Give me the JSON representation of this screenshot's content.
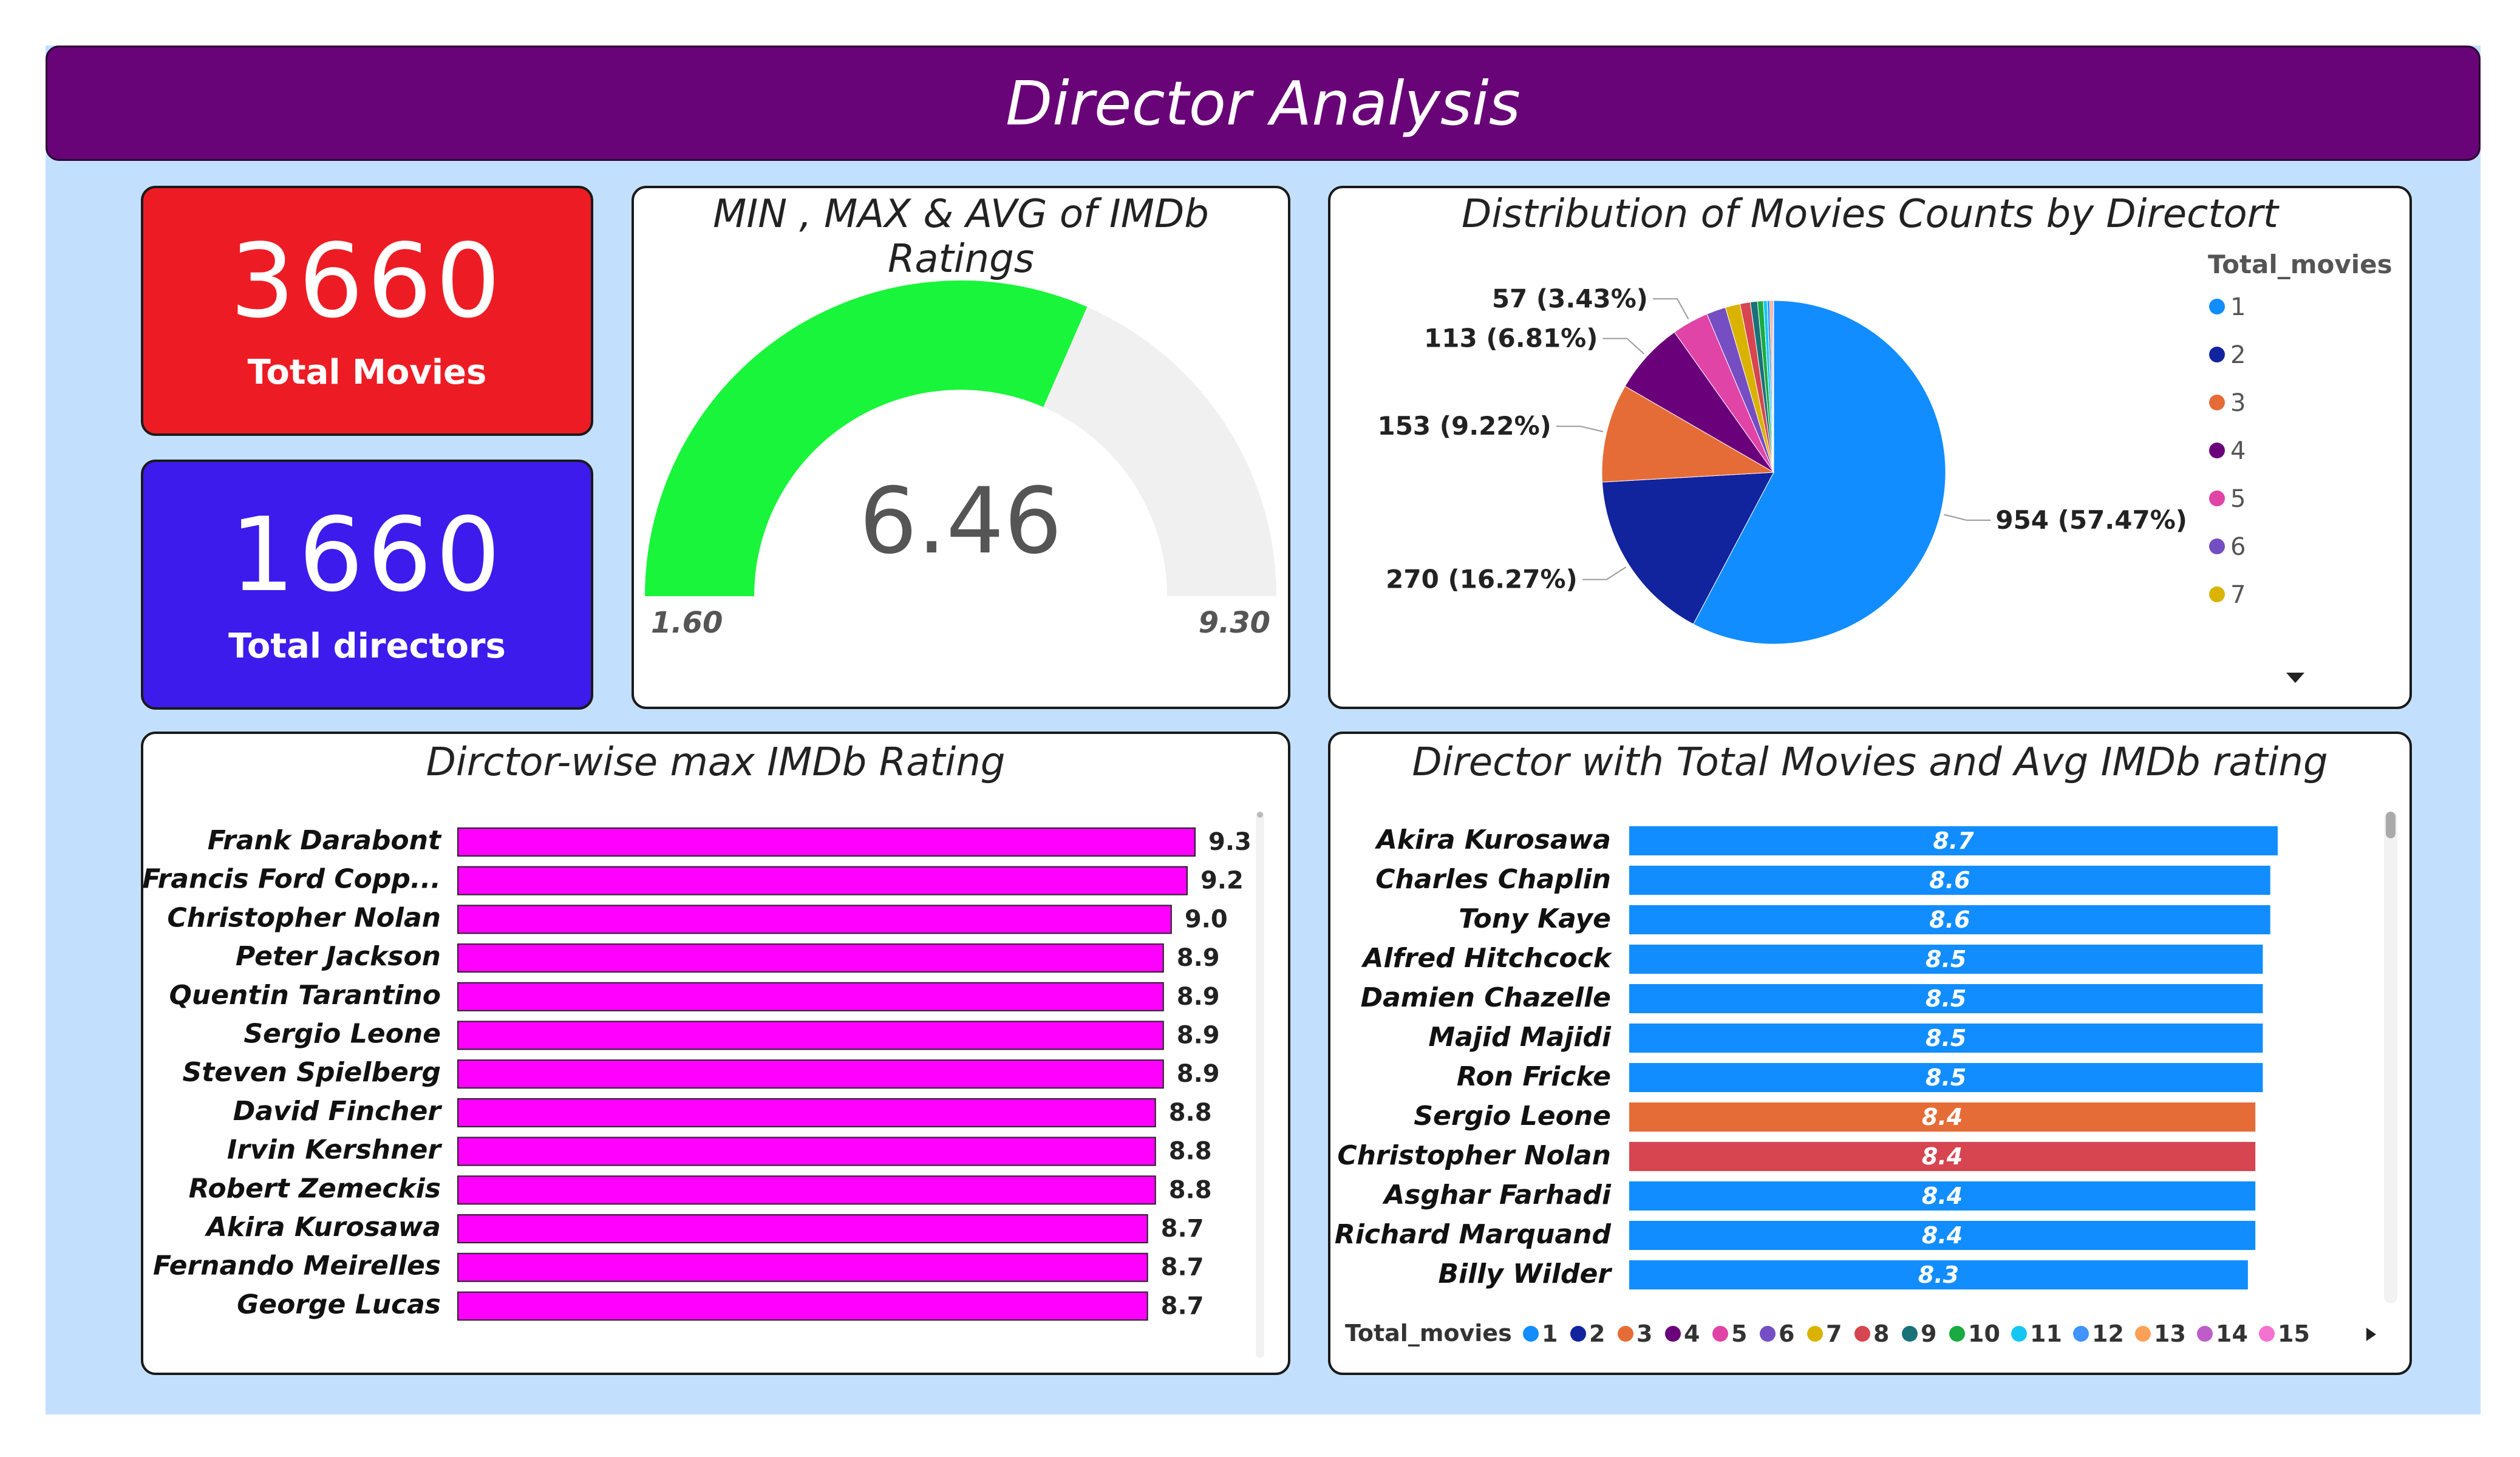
{
  "header": {
    "title": "Director Analysis"
  },
  "kpis": {
    "total_movies": {
      "value": "3660",
      "label": "Total Movies",
      "color": "#ed1c24"
    },
    "total_directors": {
      "value": "1660",
      "label": "Total directors",
      "color": "#3d1bec"
    }
  },
  "gauge": {
    "title": "MIN , MAX & AVG of IMDb Ratings",
    "value_label": "6.46",
    "min_label": "1.60",
    "max_label": "9.30",
    "min": 1.6,
    "max": 9.3,
    "value": 6.46,
    "fill_color": "#19f53a",
    "track_color": "#f0f0f0"
  },
  "pie": {
    "title": "Distribution of Movies Counts by Directort",
    "legend_title": "Total_movies",
    "legend_items": [
      {
        "label": "1",
        "color": "#118dff"
      },
      {
        "label": "2",
        "color": "#12239e"
      },
      {
        "label": "3",
        "color": "#e66c37"
      },
      {
        "label": "4",
        "color": "#6b007b"
      },
      {
        "label": "5",
        "color": "#e044a7"
      },
      {
        "label": "6",
        "color": "#744ec2"
      },
      {
        "label": "7",
        "color": "#d9b300"
      }
    ]
  },
  "bar_left": {
    "title": "Dirctor-wise max IMDb Rating"
  },
  "bar_right": {
    "title": "Director with Total Movies and Avg IMDb rating",
    "legend_title": "Total_movies",
    "legend_items": [
      {
        "label": "1",
        "color": "#118dff"
      },
      {
        "label": "2",
        "color": "#12239e"
      },
      {
        "label": "3",
        "color": "#e66c37"
      },
      {
        "label": "4",
        "color": "#6b007b"
      },
      {
        "label": "5",
        "color": "#e044a7"
      },
      {
        "label": "6",
        "color": "#744ec2"
      },
      {
        "label": "7",
        "color": "#d9b300"
      },
      {
        "label": "8",
        "color": "#d64550"
      },
      {
        "label": "9",
        "color": "#197278"
      },
      {
        "label": "10",
        "color": "#1aab40"
      },
      {
        "label": "11",
        "color": "#15c6f4"
      },
      {
        "label": "12",
        "color": "#4092ff"
      },
      {
        "label": "13",
        "color": "#ffa058"
      },
      {
        "label": "14",
        "color": "#be5dc9"
      },
      {
        "label": "15",
        "color": "#f472d0"
      }
    ]
  },
  "chart_data": [
    {
      "type": "gauge",
      "title": "MIN , MAX & AVG of IMDb Ratings",
      "min": 1.6,
      "max": 9.3,
      "value": 6.46
    },
    {
      "type": "pie",
      "title": "Distribution of Movies Counts by Directort",
      "legend_title": "Total_movies",
      "slices": [
        {
          "label": "1",
          "value": 954,
          "pct": "57.47%",
          "color": "#118dff",
          "data_label": "954 (57.47%)"
        },
        {
          "label": "2",
          "value": 270,
          "pct": "16.27%",
          "color": "#12239e",
          "data_label": "270 (16.27%)"
        },
        {
          "label": "3",
          "value": 153,
          "pct": "9.22%",
          "color": "#e66c37",
          "data_label": "153 (9.22%)"
        },
        {
          "label": "4",
          "value": 113,
          "pct": "6.81%",
          "color": "#6b007b",
          "data_label": "113 (6.81%)"
        },
        {
          "label": "5",
          "value": 57,
          "pct": "3.43%",
          "color": "#e044a7",
          "data_label": "57 (3.43%)"
        },
        {
          "label": "6",
          "value": 30,
          "color": "#744ec2"
        },
        {
          "label": "7",
          "value": 23,
          "color": "#d9b300"
        },
        {
          "label": "8",
          "value": 16,
          "color": "#d64550"
        },
        {
          "label": "9",
          "value": 11,
          "color": "#197278"
        },
        {
          "label": "10",
          "value": 9,
          "color": "#1aab40"
        },
        {
          "label": "11",
          "value": 6,
          "color": "#15c6f4"
        },
        {
          "label": "12",
          "value": 4,
          "color": "#4092ff"
        },
        {
          "label": "13",
          "value": 3,
          "color": "#ffa058"
        },
        {
          "label": "14",
          "value": 2,
          "color": "#be5dc9"
        },
        {
          "label": "15",
          "value": 1,
          "color": "#f472d0"
        }
      ]
    },
    {
      "type": "bar",
      "orientation": "horizontal",
      "title": "Dirctor-wise max IMDb Rating",
      "color": "#ff00ff",
      "categories": [
        "Frank Darabont",
        "Francis Ford Copp...",
        "Christopher Nolan",
        "Peter Jackson",
        "Quentin Tarantino",
        "Sergio Leone",
        "Steven Spielberg",
        "David Fincher",
        "Irvin Kershner",
        "Robert Zemeckis",
        "Akira Kurosawa",
        "Fernando Meirelles",
        "George Lucas"
      ],
      "values": [
        9.3,
        9.2,
        9.0,
        8.9,
        8.9,
        8.9,
        8.9,
        8.8,
        8.8,
        8.8,
        8.7,
        8.7,
        8.7
      ],
      "labels": [
        "9.3",
        "9.2",
        "9.0",
        "8.9",
        "8.9",
        "8.9",
        "8.9",
        "8.8",
        "8.8",
        "8.8",
        "8.7",
        "8.7",
        "8.7"
      ],
      "xlim": [
        0,
        9.3
      ]
    },
    {
      "type": "bar",
      "orientation": "horizontal",
      "title": "Director with Total Movies and Avg IMDb rating",
      "legend_title": "Total_movies",
      "categories": [
        "Akira Kurosawa",
        "Charles Chaplin",
        "Tony Kaye",
        "Alfred Hitchcock",
        "Damien Chazelle",
        "Majid Majidi",
        "Ron Fricke",
        "Sergio Leone",
        "Christopher Nolan",
        "Asghar Farhadi",
        "Richard Marquand",
        "Billy Wilder"
      ],
      "values": [
        8.7,
        8.6,
        8.6,
        8.5,
        8.5,
        8.5,
        8.5,
        8.4,
        8.4,
        8.4,
        8.4,
        8.3
      ],
      "labels": [
        "8.7",
        "8.6",
        "8.6",
        "8.5",
        "8.5",
        "8.5",
        "8.5",
        "8.4",
        "8.4",
        "8.4",
        "8.4",
        "8.3"
      ],
      "colors": [
        "#118dff",
        "#118dff",
        "#118dff",
        "#118dff",
        "#118dff",
        "#118dff",
        "#118dff",
        "#e66c37",
        "#d64550",
        "#118dff",
        "#118dff",
        "#118dff"
      ],
      "xlim": [
        0,
        8.7
      ]
    }
  ]
}
